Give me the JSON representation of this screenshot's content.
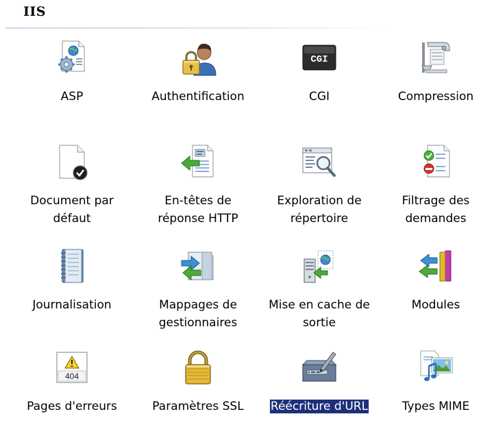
{
  "group": {
    "title": "IIS"
  },
  "features": [
    {
      "label": "ASP",
      "icon": "asp-icon"
    },
    {
      "label": "Authentification",
      "icon": "authentication-icon"
    },
    {
      "label": "CGI",
      "icon": "cgi-icon"
    },
    {
      "label": "Compression",
      "icon": "compression-icon"
    },
    {
      "label": "Document par\ndéfaut",
      "icon": "default-document-icon"
    },
    {
      "label": "En-têtes de\nréponse HTTP",
      "icon": "http-response-headers-icon"
    },
    {
      "label": "Exploration de\nrépertoire",
      "icon": "directory-browsing-icon"
    },
    {
      "label": "Filtrage des\ndemandes",
      "icon": "request-filtering-icon"
    },
    {
      "label": "Journalisation",
      "icon": "logging-icon"
    },
    {
      "label": "Mappages de\ngestionnaires",
      "icon": "handler-mappings-icon"
    },
    {
      "label": "Mise en cache de\nsortie",
      "icon": "output-caching-icon"
    },
    {
      "label": "Modules",
      "icon": "modules-icon"
    },
    {
      "label": "Pages d'erreurs",
      "icon": "error-pages-icon"
    },
    {
      "label": "Paramètres SSL",
      "icon": "ssl-settings-icon"
    },
    {
      "label": "Réécriture d'URL",
      "icon": "url-rewrite-icon",
      "selected": true
    },
    {
      "label": "Types MIME",
      "icon": "mime-types-icon"
    }
  ],
  "icon_text": {
    "cgi": "CGI",
    "error": "404"
  },
  "colors": {
    "selection_background": "#1d2f7b",
    "selection_text": "#ffffff",
    "header_rule": "#c9d7ea"
  }
}
